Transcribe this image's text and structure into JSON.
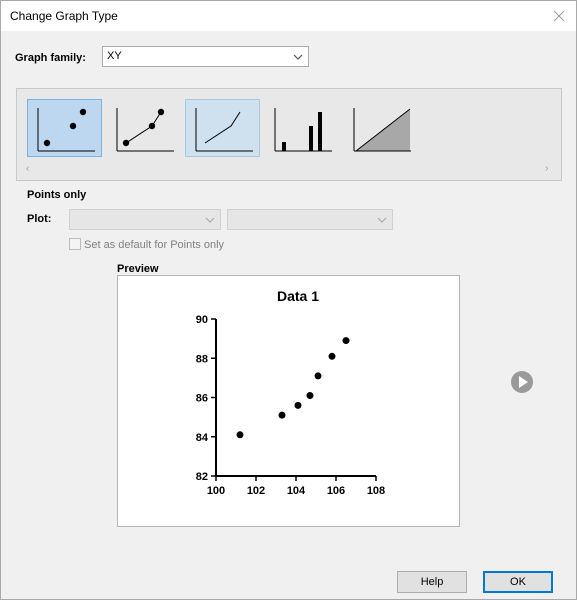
{
  "window": {
    "title": "Change Graph Type"
  },
  "graph_family": {
    "label": "Graph family:",
    "value": "XY"
  },
  "graph_types": [
    {
      "name": "points-only-icon",
      "state": "selected"
    },
    {
      "name": "points-connected-icon",
      "state": "normal"
    },
    {
      "name": "line-only-icon",
      "state": "hover"
    },
    {
      "name": "bar-spikes-icon",
      "state": "normal"
    },
    {
      "name": "area-fill-icon",
      "state": "normal"
    }
  ],
  "selected_type_label": "Points only",
  "plot": {
    "label": "Plot:",
    "select1": "",
    "select2": ""
  },
  "default_checkbox": {
    "label": "Set as default for Points only",
    "checked": false
  },
  "preview": {
    "label": "Preview"
  },
  "chart_data": {
    "type": "scatter",
    "title": "Data 1",
    "xlabel": "",
    "ylabel": "",
    "xlim": [
      100,
      108
    ],
    "ylim": [
      82,
      90
    ],
    "x_ticks": [
      "100",
      "102",
      "104",
      "106",
      "108"
    ],
    "y_ticks": [
      "82",
      "84",
      "86",
      "88",
      "90"
    ],
    "points": [
      {
        "x": 101.2,
        "y": 84.1
      },
      {
        "x": 103.3,
        "y": 85.1
      },
      {
        "x": 104.1,
        "y": 85.6
      },
      {
        "x": 104.7,
        "y": 86.1
      },
      {
        "x": 105.1,
        "y": 87.1
      },
      {
        "x": 105.8,
        "y": 88.1
      },
      {
        "x": 106.5,
        "y": 88.9
      }
    ],
    "grid": false
  },
  "buttons": {
    "help": "Help",
    "ok": "OK"
  },
  "colors": {
    "selected_bg": "#bcd7ef",
    "accent": "#0078d7"
  }
}
